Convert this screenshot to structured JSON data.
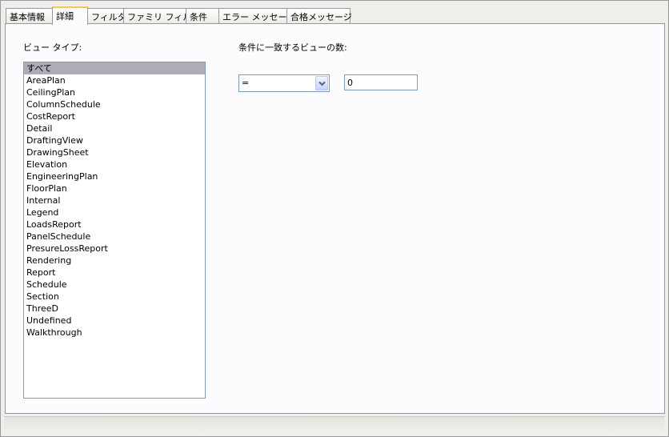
{
  "tabs": [
    {
      "label": "基本情報"
    },
    {
      "label": "詳細"
    },
    {
      "label": "フィルタ"
    },
    {
      "label": "ファミリ フィルタ"
    },
    {
      "label": "条件"
    },
    {
      "label": "エラー メッセージ"
    },
    {
      "label": "合格メッセージ"
    }
  ],
  "active_tab": "詳細",
  "view_type_label": "ビュー タイプ:",
  "view_types": [
    "すべて",
    "AreaPlan",
    "CeilingPlan",
    "ColumnSchedule",
    "CostReport",
    "Detail",
    "DraftingView",
    "DrawingSheet",
    "Elevation",
    "EngineeringPlan",
    "FloorPlan",
    "Internal",
    "Legend",
    "LoadsReport",
    "PanelSchedule",
    "PresureLossReport",
    "Rendering",
    "Report",
    "Schedule",
    "Section",
    "ThreeD",
    "Undefined",
    "Walkthrough"
  ],
  "selected_view_type": "すべて",
  "count_label": "条件に一致するビューの数:",
  "operator": {
    "value": "="
  },
  "count_value": "0"
}
